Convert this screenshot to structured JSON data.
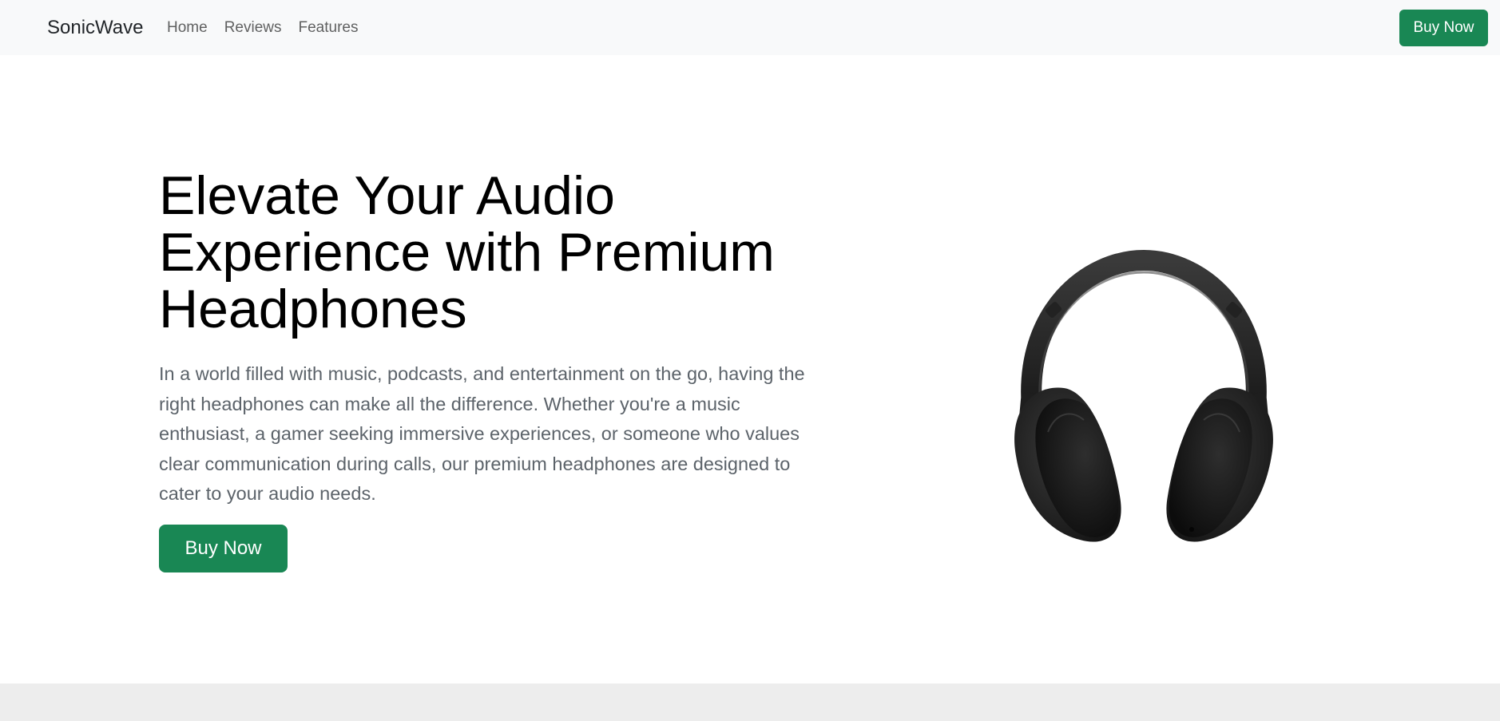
{
  "navbar": {
    "brand": "SonicWave",
    "links": [
      "Home",
      "Reviews",
      "Features"
    ],
    "buy_label": "Buy Now"
  },
  "hero": {
    "title": "Elevate Your Audio Experience with Premium Headphones",
    "description": "In a world filled with music, podcasts, and entertainment on the go, having the right headphones can make all the difference. Whether you're a music enthusiast, a gamer seeking immersive experiences, or someone who values clear communication during calls, our premium headphones are designed to cater to your audio needs.",
    "buy_label": "Buy Now",
    "image_icon": "headphones-image"
  },
  "colors": {
    "primary": "#198754",
    "navbar_bg": "#f8f9fa",
    "footer_bg": "#ededed"
  }
}
